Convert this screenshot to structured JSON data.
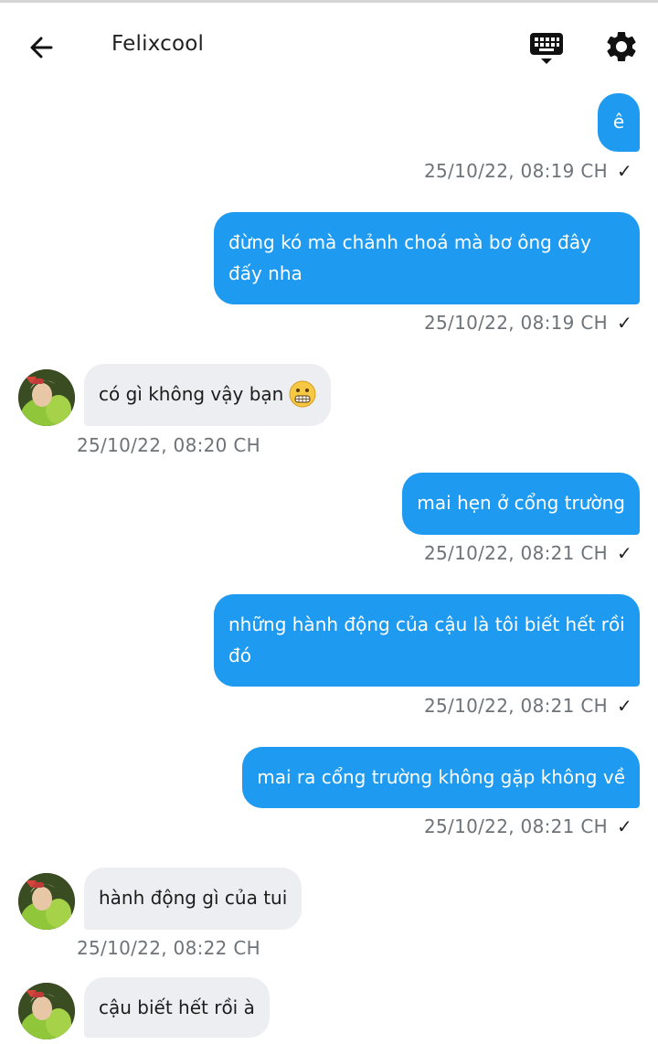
{
  "header": {
    "title": "Felixcool"
  },
  "icons": {
    "back": "arrow-left-icon",
    "keyboard": "keyboard-hide-icon",
    "settings": "gear-icon",
    "emoji": "grimacing-face-emoji"
  },
  "colors": {
    "outgoing_bubble": "#1e9bf0",
    "incoming_bubble": "#eceef1",
    "timestamp": "#6e7378"
  },
  "messages": [
    {
      "dir": "out",
      "text": "ê",
      "time": "25/10/22,  08:19 CH",
      "read": true
    },
    {
      "dir": "out",
      "text": "đừng kó mà chảnh choá mà bơ ông đây đấy nha",
      "time": "25/10/22,  08:19 CH",
      "read": true
    },
    {
      "dir": "in",
      "text": "có gì không vậy bạn",
      "time": "25/10/22,  08:20 CH"
    },
    {
      "dir": "out",
      "text": "mai hẹn ở cổng trường",
      "time": "25/10/22,  08:21 CH",
      "read": true
    },
    {
      "dir": "out",
      "text": "những hành động của cậu là tôi biết hết rồi đó",
      "time": "25/10/22,  08:21 CH",
      "read": true
    },
    {
      "dir": "out",
      "text": "mai ra cổng trường không gặp không về",
      "time": "25/10/22,  08:21 CH",
      "read": true
    },
    {
      "dir": "in",
      "text": "hành động gì của tui",
      "time": "25/10/22,  08:22 CH"
    },
    {
      "dir": "in",
      "text": "cậu biết hết rồi à",
      "time": ""
    }
  ],
  "read_mark": "✓"
}
